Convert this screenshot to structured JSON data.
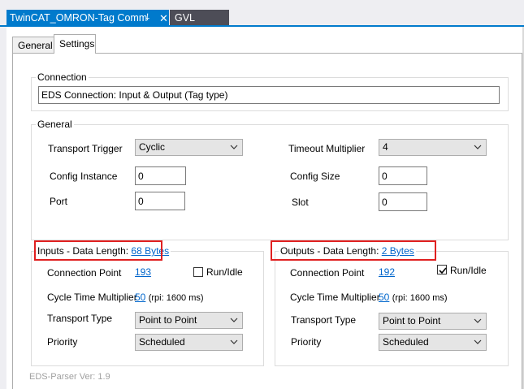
{
  "doc_tabs": {
    "active": {
      "label": "TwinCAT_OMRON-Tag Comm",
      "pin": "⸸",
      "close": "✕"
    },
    "inactive": {
      "label": "GVL"
    }
  },
  "tabs": {
    "general": "General",
    "settings": "Settings"
  },
  "connection": {
    "title": "Connection",
    "value": "EDS Connection: Input & Output (Tag type)"
  },
  "general": {
    "title": "General",
    "transport_trigger": {
      "label": "Transport Trigger",
      "value": "Cyclic"
    },
    "config_instance": {
      "label": "Config Instance",
      "value": "0"
    },
    "port": {
      "label": "Port",
      "value": "0"
    },
    "timeout_multiplier": {
      "label": "Timeout Multiplier",
      "value": "4"
    },
    "config_size": {
      "label": "Config Size",
      "value": "0"
    },
    "slot": {
      "label": "Slot",
      "value": "0"
    }
  },
  "inputs": {
    "title_prefix": "Inputs - Data Length: ",
    "data_length": "68 Bytes",
    "connection_point": {
      "label": "Connection Point",
      "value": "193"
    },
    "run_idle": {
      "label": "Run/Idle",
      "checked": false
    },
    "cycle_time": {
      "label": "Cycle Time Multiplier",
      "value": "50",
      "rpi": "(rpi: 1600 ms)"
    },
    "transport_type": {
      "label": "Transport Type",
      "value": "Point to Point"
    },
    "priority": {
      "label": "Priority",
      "value": "Scheduled"
    }
  },
  "outputs": {
    "title_prefix": "Outputs - Data Length: ",
    "data_length": "2 Bytes",
    "connection_point": {
      "label": "Connection Point",
      "value": "192"
    },
    "run_idle": {
      "label": "Run/Idle",
      "checked": true
    },
    "cycle_time": {
      "label": "Cycle Time Multiplier",
      "value": "50",
      "rpi": "(rpi: 1600 ms)"
    },
    "transport_type": {
      "label": "Transport Type",
      "value": "Point to Point"
    },
    "priority": {
      "label": "Priority",
      "value": "Scheduled"
    }
  },
  "footer": {
    "parser_version": "EDS-Parser Ver: 1.9"
  },
  "colors": {
    "accent": "#007acc",
    "highlight_box": "#e02020",
    "link": "#0066cc"
  }
}
